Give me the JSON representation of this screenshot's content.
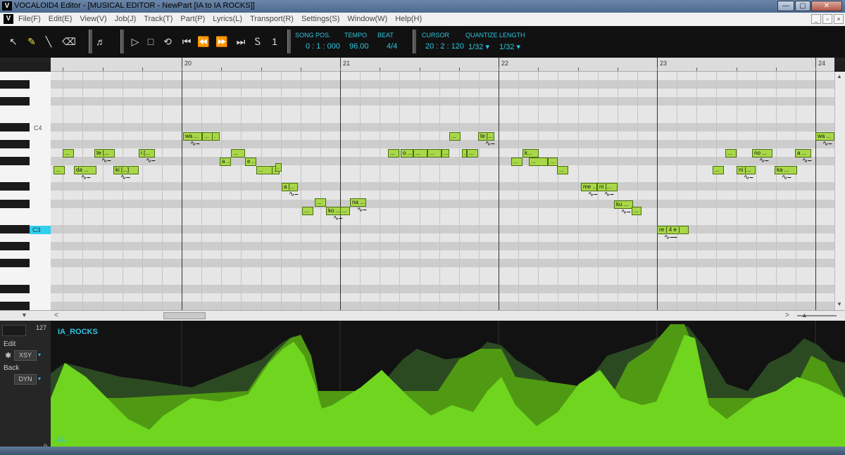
{
  "window": {
    "title": "VOCALOID4 Editor - [MUSICAL EDITOR - NewPart [IA to IA ROCKS]]",
    "logo": "V",
    "buttons": [
      "—",
      "▢",
      "✕"
    ],
    "mdi_buttons": [
      "_",
      "▫",
      "×"
    ]
  },
  "menu": {
    "logo": "V",
    "items": [
      "File(F)",
      "Edit(E)",
      "View(V)",
      "Job(J)",
      "Track(T)",
      "Part(P)",
      "Lyrics(L)",
      "Transport(R)",
      "Settings(S)",
      "Window(W)",
      "Help(H)"
    ]
  },
  "toolbar": {
    "tools": [
      {
        "name": "arrow-tool-icon",
        "glyph": "↖"
      },
      {
        "name": "pencil-tool-icon",
        "glyph": "✎"
      },
      {
        "name": "line-tool-icon",
        "glyph": "╲"
      },
      {
        "name": "eraser-tool-icon",
        "glyph": "⌫"
      },
      {
        "name": "score-view-icon",
        "glyph": "♬"
      },
      {
        "name": "play-icon",
        "glyph": "▷"
      },
      {
        "name": "stop-icon",
        "glyph": "□"
      },
      {
        "name": "loop-icon",
        "glyph": "⟲"
      },
      {
        "name": "go-start-icon",
        "glyph": "⏮"
      },
      {
        "name": "rewind-icon",
        "glyph": "⏪"
      },
      {
        "name": "fast-forward-icon",
        "glyph": "⏩"
      },
      {
        "name": "go-end-icon",
        "glyph": "⏭"
      },
      {
        "name": "start-marker-icon",
        "glyph": "Ꮪ"
      },
      {
        "name": "end-marker-icon",
        "glyph": "1"
      }
    ],
    "song_pos_label": "SONG POS.",
    "song_pos_value": "0 : 1 : 000",
    "tempo_label": "TEMPO",
    "tempo_value": "96.00",
    "beat_label": "BEAT",
    "beat_value": "4/4",
    "cursor_label": "CURSOR",
    "cursor_value": "20 : 2 : 120",
    "quantize_label": "QUANTIZE",
    "quantize_value": "1/32 ▾",
    "length_label": "LENGTH",
    "length_value": "1/32 ▾"
  },
  "ruler": {
    "measures": [
      "20",
      "21",
      "22",
      "23",
      "24"
    ]
  },
  "keyboard": {
    "c4_label": "C4",
    "c3_label": "C3"
  },
  "notes": [
    {
      "row": 11,
      "start": 0.19,
      "len": 0.07,
      "lyric": "..."
    },
    {
      "row": 9,
      "start": 0.25,
      "len": 0.07,
      "lyric": "..."
    },
    {
      "row": 11,
      "start": 0.32,
      "len": 0.14,
      "lyric": "da ..."
    },
    {
      "row": 9,
      "start": 0.45,
      "len": 0.13,
      "lyric": "te [..."
    },
    {
      "row": 11,
      "start": 0.57,
      "len": 0.16,
      "lyric": "ki [...]"
    },
    {
      "row": 9,
      "start": 0.73,
      "len": 0.1,
      "lyric": "i [..."
    },
    {
      "row": 7,
      "start": 1.01,
      "len": 0.12,
      "lyric": "wa ..."
    },
    {
      "row": 7,
      "start": 1.13,
      "len": 0.07,
      "lyric": "..."
    },
    {
      "row": 7,
      "start": 1.19,
      "len": 0.05,
      "lyric": "."
    },
    {
      "row": 10,
      "start": 1.24,
      "len": 0.07,
      "lyric": "a ..."
    },
    {
      "row": 9,
      "start": 1.31,
      "len": 0.09,
      "lyric": "..."
    },
    {
      "row": 10,
      "start": 1.4,
      "len": 0.07,
      "lyric": "e ..."
    },
    {
      "row": 11,
      "start": 1.47,
      "len": 0.1,
      "lyric": "..."
    },
    {
      "row": 11,
      "start": 1.57,
      "len": 0.05,
      "lyric": "..."
    },
    {
      "row": 10.7,
      "start": 1.59,
      "len": 0.04,
      "lyric": "."
    },
    {
      "row": 13,
      "start": 1.63,
      "len": 0.1,
      "lyric": "a [..."
    },
    {
      "row": 15.8,
      "start": 1.76,
      "len": 0.07,
      "lyric": "..."
    },
    {
      "row": 14.8,
      "start": 1.84,
      "len": 0.07,
      "lyric": "..."
    },
    {
      "row": 15.8,
      "start": 1.91,
      "len": 0.1,
      "lyric": "ko ..."
    },
    {
      "row": 15.8,
      "start": 2.0,
      "len": 0.06,
      "lyric": "..."
    },
    {
      "row": 14.8,
      "start": 2.06,
      "len": 0.1,
      "lyric": "na ..."
    },
    {
      "row": 9,
      "start": 2.3,
      "len": 0.07,
      "lyric": "..."
    },
    {
      "row": 9,
      "start": 2.38,
      "len": 0.08,
      "lyric": "o ..."
    },
    {
      "row": 9,
      "start": 2.46,
      "len": 0.09,
      "lyric": "..."
    },
    {
      "row": 9,
      "start": 2.55,
      "len": 0.09,
      "lyric": "..."
    },
    {
      "row": 9,
      "start": 2.64,
      "len": 0.05,
      "lyric": "..."
    },
    {
      "row": 7,
      "start": 2.69,
      "len": 0.07,
      "lyric": "..."
    },
    {
      "row": 9,
      "start": 2.77,
      "len": 0.03,
      "lyric": "."
    },
    {
      "row": 9,
      "start": 2.8,
      "len": 0.07,
      "lyric": "..."
    },
    {
      "row": 7,
      "start": 2.87,
      "len": 0.1,
      "lyric": "te [..."
    },
    {
      "row": 10,
      "start": 3.08,
      "len": 0.07,
      "lyric": "..."
    },
    {
      "row": 9,
      "start": 3.15,
      "len": 0.1,
      "lyric": "k..."
    },
    {
      "row": 10,
      "start": 3.19,
      "len": 0.12,
      "lyric": "..."
    },
    {
      "row": 10,
      "start": 3.31,
      "len": 0.06,
      "lyric": "..."
    },
    {
      "row": 11,
      "start": 3.37,
      "len": 0.07,
      "lyric": "..."
    },
    {
      "row": 13,
      "start": 3.52,
      "len": 0.1,
      "lyric": "me ..."
    },
    {
      "row": 13,
      "start": 3.62,
      "len": 0.13,
      "lyric": "ni [..."
    },
    {
      "row": 15,
      "start": 3.73,
      "len": 0.12,
      "lyric": "ku ..."
    },
    {
      "row": 15.8,
      "start": 3.84,
      "len": 0.06,
      "lyric": "..."
    },
    {
      "row": 18,
      "start": 4.0,
      "len": 0.2,
      "lyric": "re [ 4 e ]"
    },
    {
      "row": 11,
      "start": 4.35,
      "len": 0.07,
      "lyric": "..."
    },
    {
      "row": 9,
      "start": 4.43,
      "len": 0.07,
      "lyric": "..."
    },
    {
      "row": 11,
      "start": 4.5,
      "len": 0.12,
      "lyric": "ni [..."
    },
    {
      "row": 9,
      "start": 4.6,
      "len": 0.13,
      "lyric": "no ..."
    },
    {
      "row": 11,
      "start": 4.74,
      "len": 0.14,
      "lyric": "ka ..."
    },
    {
      "row": 9,
      "start": 4.87,
      "len": 0.1,
      "lyric": "a ..."
    },
    {
      "row": 7,
      "start": 5.0,
      "len": 0.12,
      "lyric": "wa ..."
    }
  ],
  "control": {
    "max_value": "127",
    "min_value": "0",
    "edit_label": "Edit",
    "edit_mode": "XSY",
    "back_label": "Back",
    "back_mode": "DYN",
    "track_name": "IA_ROCKS",
    "singer": "IA",
    "front_color": "#6fd51f",
    "back_color": "#2c4a22",
    "mid_color": "#4f9a12"
  },
  "scrollbars": {
    "up": "▲",
    "down": "▼",
    "left": "<",
    "right": ">"
  }
}
